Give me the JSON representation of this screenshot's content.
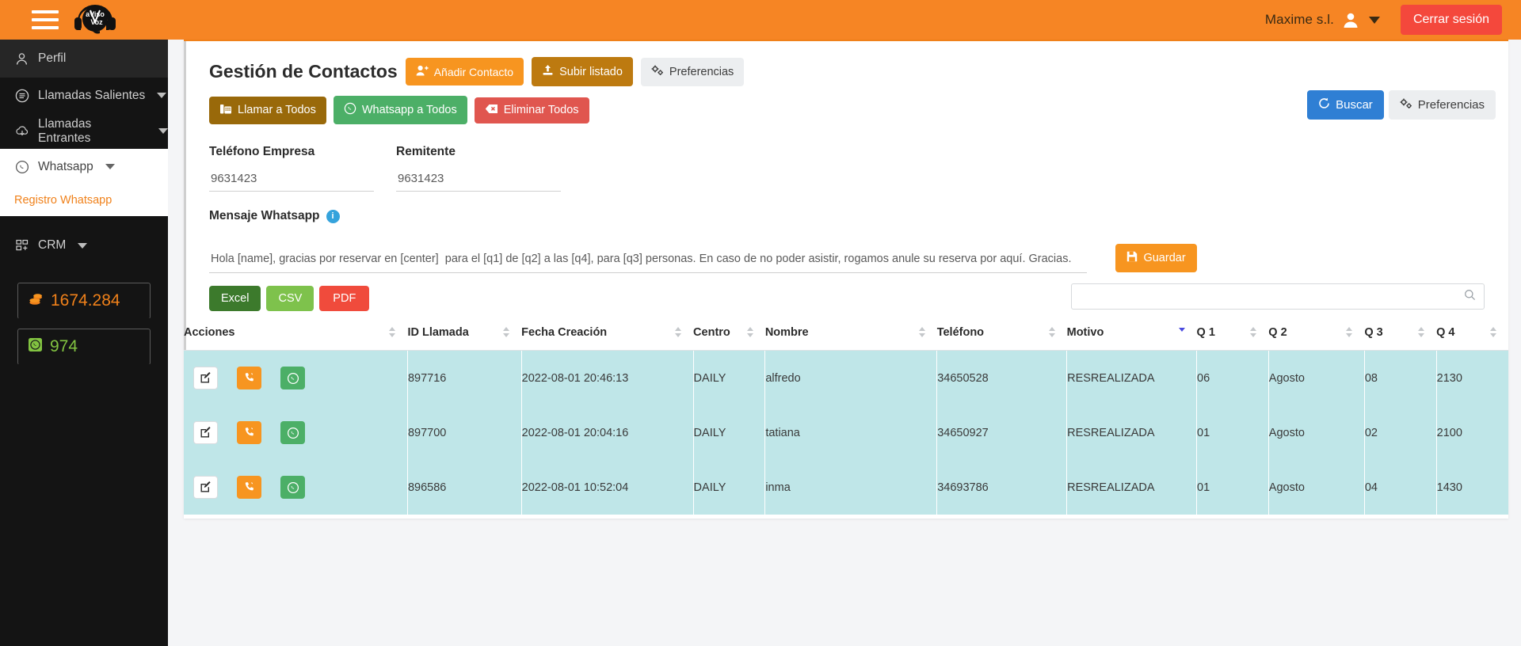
{
  "header": {
    "menu_icon": "hamburger-icon",
    "logo_text": "aVisoVoz",
    "user_name": "Maxime s.l.",
    "user_icon": "user-icon",
    "caret_icon": "chevron-down-icon",
    "logout_label": "Cerrar sesión",
    "brand_color": "#f68524",
    "logout_color": "#f4483c"
  },
  "sidebar": {
    "items": [
      {
        "label": "Perfil",
        "icon": "profile-icon",
        "caret": false,
        "active": true
      },
      {
        "label": "Llamadas Salientes",
        "icon": "outgoing-calls-icon",
        "caret": true,
        "active": false
      },
      {
        "label": "Llamadas Entrantes",
        "icon": "incoming-calls-icon",
        "caret": true,
        "active": false
      },
      {
        "label": "Whatsapp",
        "icon": "whatsapp-icon",
        "caret": true,
        "active": false
      },
      {
        "label": "CRM",
        "icon": "crm-grid-icon",
        "caret": true,
        "active": false
      }
    ],
    "sub_link": "Registro Whatsapp",
    "sub_link_color": "#f0811a",
    "counters": [
      {
        "icon": "coins-icon",
        "value": "1674.284",
        "color": "#f0811a"
      },
      {
        "icon": "whatsapp-square-icon",
        "value": "974",
        "color": "#82c341"
      }
    ]
  },
  "main": {
    "page_title": "Gestión de Contactos",
    "head_buttons": [
      {
        "label": "Añadir Contacto",
        "icon": "user-plus-icon",
        "color": "#f79520"
      },
      {
        "label": "Subir listado",
        "icon": "upload-icon",
        "color": "#bd7a10"
      },
      {
        "label": "Preferencias",
        "icon": "gears-icon",
        "color": "#eceef0"
      }
    ],
    "action_buttons": [
      {
        "label": "Llamar a Todos",
        "icon": "telephone-icon",
        "color": "#99690a"
      },
      {
        "label": "Whatsapp a Todos",
        "icon": "whatsapp-icon",
        "color": "#4caf67"
      },
      {
        "label": "Eliminar Todos",
        "icon": "delete-icon",
        "color": "#e0564f"
      }
    ],
    "right_buttons": [
      {
        "label": "Buscar",
        "icon": "search-refresh-icon",
        "color": "#2f7fd4"
      },
      {
        "label": "Preferencias",
        "icon": "gears-icon",
        "color": "#eceef0"
      }
    ],
    "form": {
      "phone_label": "Teléfono Empresa",
      "phone_value": "9631423",
      "sender_label": "Remitente",
      "sender_value": "9631423",
      "message_label": "Mensaje Whatsapp",
      "message_info_icon": "info-icon",
      "message_value": "Hola [name], gracias por reservar en [center]  para el [q1] de [q2] a las [q4], para [q3] personas. En caso de no poder asistir, rogamos anule su reserva por aquí. Gracias.",
      "save_label": "Guardar",
      "save_icon": "save-icon"
    },
    "export_buttons": [
      {
        "label": "Excel",
        "color": "#3c7a2c"
      },
      {
        "label": "CSV",
        "color": "#7ec24c"
      },
      {
        "label": "PDF",
        "color": "#f04b3c"
      }
    ],
    "table_search_placeholder": "",
    "table_search_value": "",
    "search_icon": "search-icon",
    "table": {
      "columns": [
        {
          "label": "Acciones",
          "sortable": true,
          "sorted": false
        },
        {
          "label": "ID Llamada",
          "sortable": true,
          "sorted": false
        },
        {
          "label": "Fecha Creación",
          "sortable": true,
          "sorted": false
        },
        {
          "label": "Centro",
          "sortable": true,
          "sorted": false
        },
        {
          "label": "Nombre",
          "sortable": true,
          "sorted": false
        },
        {
          "label": "Teléfono",
          "sortable": true,
          "sorted": false
        },
        {
          "label": "Motivo",
          "sortable": true,
          "sorted": true
        },
        {
          "label": "Q 1",
          "sortable": true,
          "sorted": false
        },
        {
          "label": "Q 2",
          "sortable": true,
          "sorted": false
        },
        {
          "label": "Q 3",
          "sortable": true,
          "sorted": false
        },
        {
          "label": "Q 4",
          "sortable": true,
          "sorted": false
        }
      ],
      "row_actions": [
        {
          "name": "edit-row-button",
          "icon": "edit-icon"
        },
        {
          "name": "call-row-button",
          "icon": "phone-icon"
        },
        {
          "name": "whatsapp-row-button",
          "icon": "whatsapp-icon"
        }
      ],
      "rows": [
        {
          "id_llamada": "897716",
          "fecha": "2022-08-01 20:46:13",
          "centro": "DAILY",
          "nombre": "alfredo",
          "telefono": "34650528",
          "motivo": "RESREALIZADA",
          "q1": "06",
          "q2": "Agosto",
          "q3": "08",
          "q4": "2130"
        },
        {
          "id_llamada": "897700",
          "fecha": "2022-08-01 20:04:16",
          "centro": "DAILY",
          "nombre": "tatiana",
          "telefono": "34650927",
          "motivo": "RESREALIZADA",
          "q1": "01",
          "q2": "Agosto",
          "q3": "02",
          "q4": "2100"
        },
        {
          "id_llamada": "896586",
          "fecha": "2022-08-01 10:52:04",
          "centro": "DAILY",
          "nombre": "inma",
          "telefono": "34693786",
          "motivo": "RESREALIZADA",
          "q1": "01",
          "q2": "Agosto",
          "q3": "04",
          "q4": "1430"
        }
      ]
    }
  }
}
